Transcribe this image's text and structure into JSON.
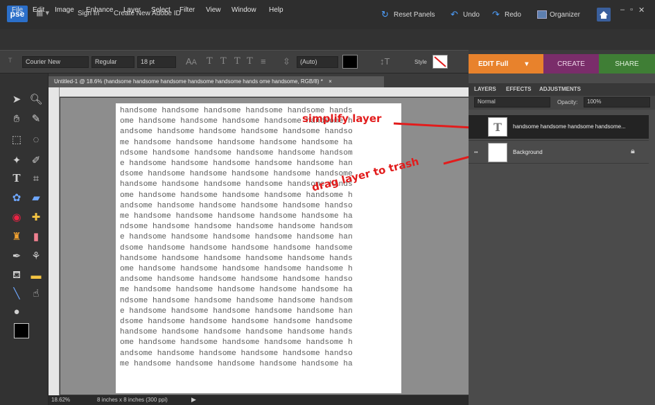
{
  "app": {
    "logo": "pse",
    "sign_in": "Sign In",
    "create_id": "Create New Adobe ID",
    "reset_panels": "Reset Panels",
    "undo": "Undo",
    "redo": "Redo",
    "organizer": "Organizer"
  },
  "menu": [
    "File",
    "Edit",
    "Image",
    "Enhance",
    "Layer",
    "Select",
    "Filter",
    "View",
    "Window",
    "Help"
  ],
  "options": {
    "font_family": "Courier New",
    "font_style": "Regular",
    "font_size": "18 pt",
    "leading": "(Auto)",
    "style_label": "Style"
  },
  "mode_tabs": {
    "edit": "EDIT Full",
    "create": "CREATE",
    "share": "SHARE"
  },
  "document": {
    "tab_title": "Untitled-1 @ 18.6% (handsome handsome handsome handsome handsome hands ome handsome, RGB/8) *",
    "close": "×",
    "text_lines": [
      "handsome handsome handsome handsome handsome hands",
      "ome handsome handsome handsome handsome handsome h",
      "andsome handsome handsome handsome handsome handso",
      "me handsome handsome handsome handsome handsome ha",
      "ndsome handsome handsome handsome handsome handsom",
      "e handsome handsome handsome handsome handsome han",
      "dsome handsome handsome handsome handsome handsome",
      "handsome handsome handsome handsome handsome hands",
      "ome handsome handsome handsome handsome handsome h",
      "andsome handsome handsome handsome handsome handso",
      "me handsome handsome handsome handsome handsome ha",
      "ndsome handsome handsome handsome handsome handsom",
      "e handsome handsome handsome handsome handsome han",
      "dsome handsome handsome handsome handsome handsome",
      "handsome handsome handsome handsome handsome hands",
      "ome handsome handsome handsome handsome handsome h",
      "andsome handsome handsome handsome handsome handso",
      "me handsome handsome handsome handsome handsome ha",
      "ndsome handsome handsome handsome handsome handsom",
      "e handsome handsome handsome handsome handsome han",
      "dsome handsome handsome handsome handsome handsome",
      "handsome handsome handsome handsome handsome hands",
      "ome handsome handsome handsome handsome handsome h",
      "andsome handsome handsome handsome handsome handso",
      "me handsome handsome handsome handsome handsome ha"
    ]
  },
  "annotations": {
    "simplify": "simplify layer",
    "drag": "drag layer to trash",
    "color": "#e21c1c"
  },
  "status": {
    "zoom": "18.62%",
    "doc_size": "8 inches x 8 inches (300 ppi)"
  },
  "panel": {
    "tabs": [
      "LAYERS",
      "EFFECTS",
      "ADJUSTMENTS"
    ],
    "blend_mode": "Normal",
    "opacity_label": "Opacity:",
    "opacity_value": "100%",
    "layers": [
      {
        "name": "handsome handsome handsome handsome...",
        "thumb": "T"
      },
      {
        "name": "Background",
        "thumb": ""
      }
    ]
  },
  "colors": {
    "edit_tab": "#e8822c",
    "create_tab": "#7a2d6a",
    "share_tab": "#3f7e35",
    "logo": "#2b6fc9"
  }
}
